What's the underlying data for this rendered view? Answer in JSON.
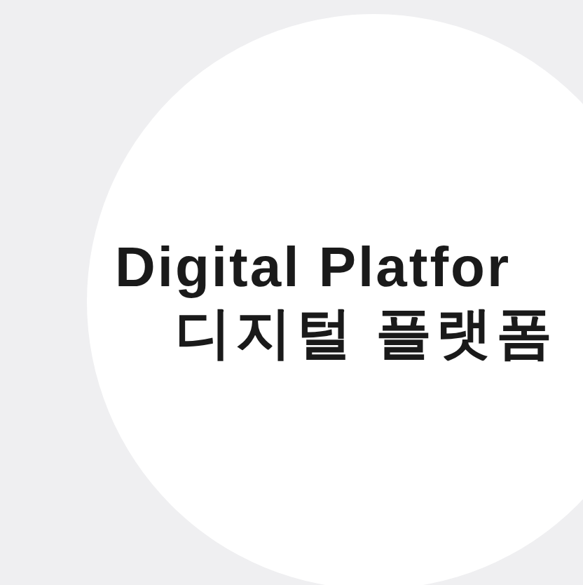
{
  "heading": {
    "title": "Digital Platfor",
    "subtitle": "디지털 플랫폼"
  }
}
